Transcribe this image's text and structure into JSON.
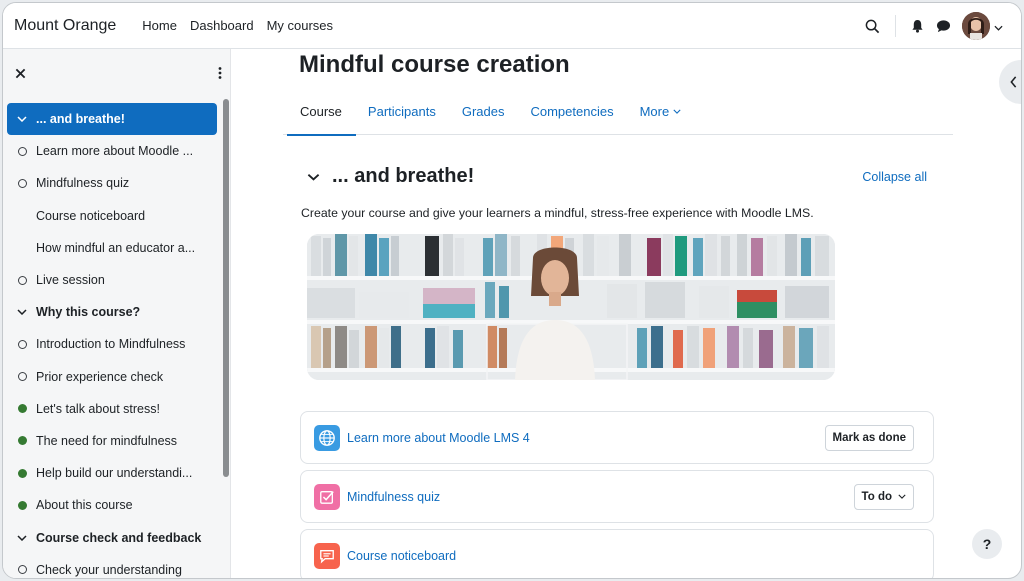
{
  "navbar": {
    "brand": "Mount Orange",
    "links": [
      "Home",
      "Dashboard",
      "My courses"
    ]
  },
  "drawer": {
    "items": [
      {
        "label": "... and breathe!",
        "kind": "section",
        "active": true
      },
      {
        "label": "Learn more about Moodle ...",
        "kind": "activity",
        "status": "incomplete"
      },
      {
        "label": "Mindfulness quiz",
        "kind": "activity",
        "status": "incomplete"
      },
      {
        "label": "Course noticeboard",
        "kind": "activity",
        "status": "none"
      },
      {
        "label": "How mindful an educator a...",
        "kind": "activity",
        "status": "none"
      },
      {
        "label": "Live session",
        "kind": "activity",
        "status": "incomplete"
      },
      {
        "label": "Why this course?",
        "kind": "section",
        "active": false
      },
      {
        "label": "Introduction to Mindfulness",
        "kind": "activity",
        "status": "incomplete"
      },
      {
        "label": "Prior experience check",
        "kind": "activity",
        "status": "incomplete"
      },
      {
        "label": "Let's talk about stress!",
        "kind": "activity",
        "status": "complete"
      },
      {
        "label": "The need for mindfulness",
        "kind": "activity",
        "status": "complete"
      },
      {
        "label": "Help build our understandi...",
        "kind": "activity",
        "status": "complete"
      },
      {
        "label": "About this course",
        "kind": "activity",
        "status": "complete"
      },
      {
        "label": "Course check and feedback",
        "kind": "section",
        "active": false
      },
      {
        "label": "Check your understanding",
        "kind": "activity",
        "status": "incomplete"
      }
    ]
  },
  "main": {
    "title": "Mindful course creation",
    "tabs": [
      "Course",
      "Participants",
      "Grades",
      "Competencies",
      "More"
    ],
    "section_title": "... and breathe!",
    "collapse_all": "Collapse all",
    "summary": "Create your course and give your learners a mindful, stress-free experience with Moodle LMS.",
    "activities": [
      {
        "label": "Learn more about Moodle LMS 4",
        "button": "Mark as done",
        "icon": "url-globe-icon",
        "color": "#399be2"
      },
      {
        "label": "Mindfulness quiz",
        "button": "To do",
        "icon": "quiz-checkbox-icon",
        "color": "#f06fa5"
      },
      {
        "label": "Course noticeboard",
        "button": "",
        "icon": "forum-chat-icon",
        "color": "#f7634d"
      }
    ]
  },
  "help": "?",
  "colors": {
    "accent": "#0f6cbf",
    "complete": "#357a32"
  }
}
